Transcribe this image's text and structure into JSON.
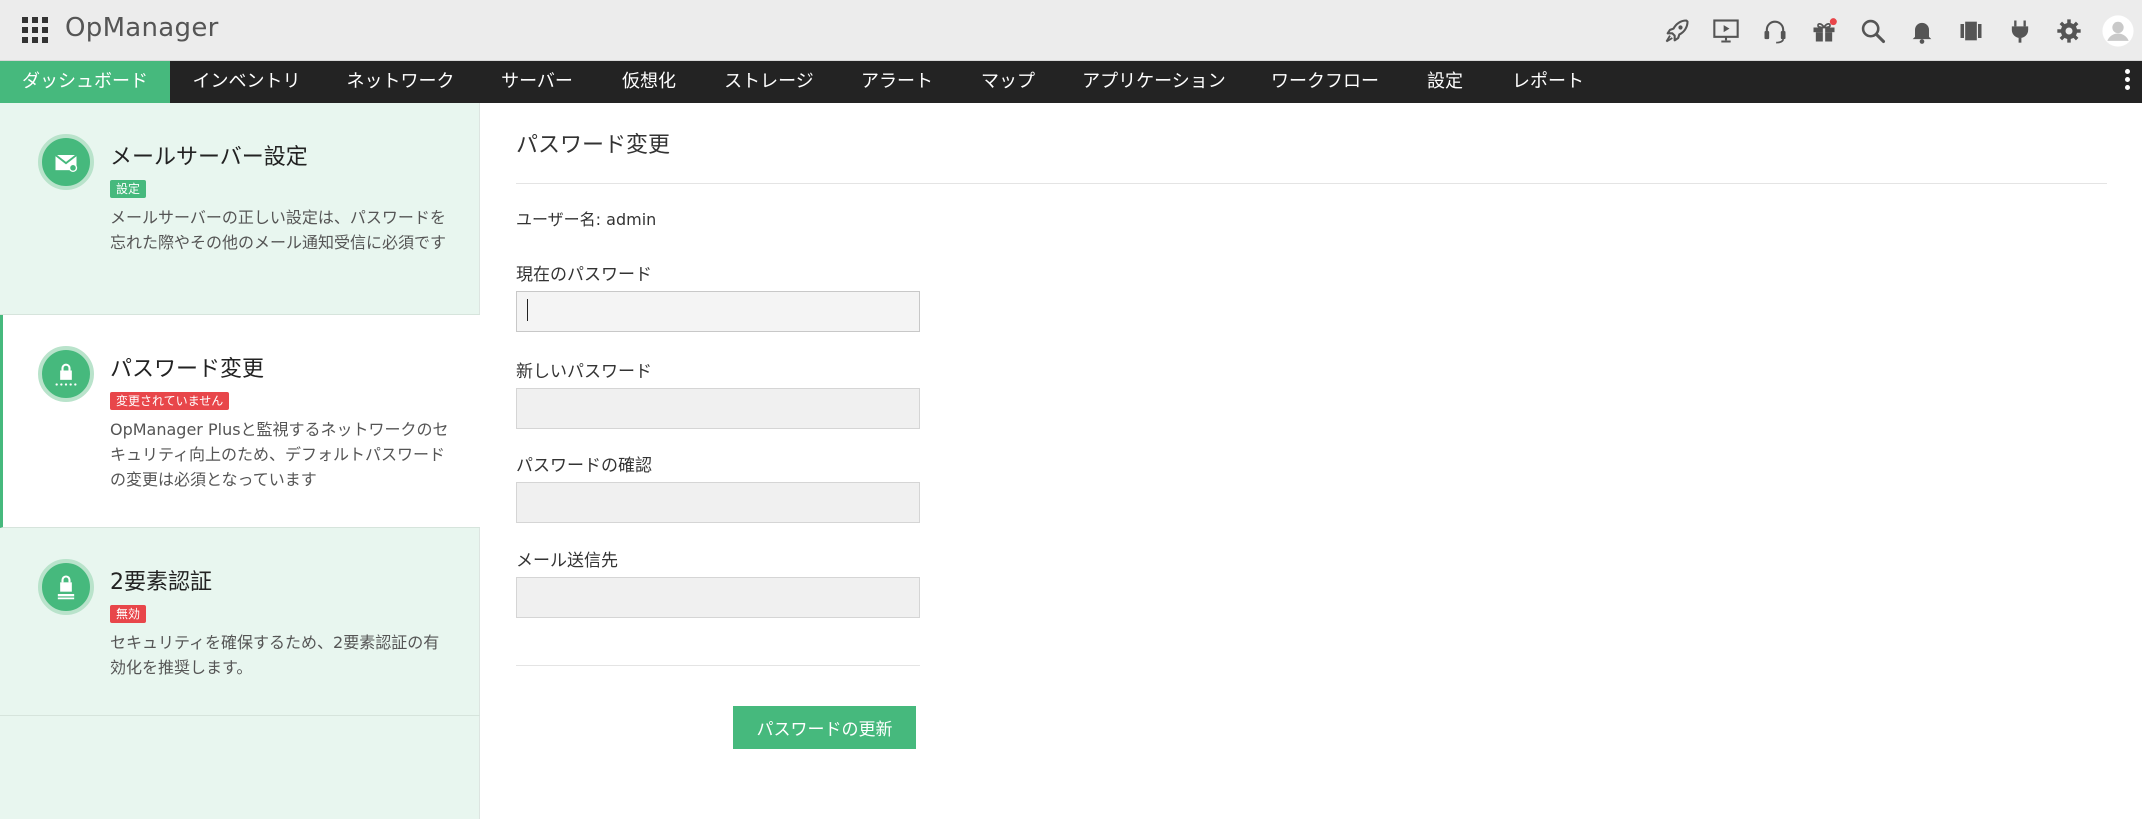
{
  "app": {
    "title": "OpManager"
  },
  "header_icons": [
    "rocket-icon",
    "presentation-icon",
    "headset-icon",
    "gift-icon",
    "search-icon",
    "bell-icon",
    "devices-icon",
    "plug-icon",
    "gear-icon",
    "avatar-icon"
  ],
  "nav": {
    "items": [
      {
        "label": "ダッシュボード",
        "active": true
      },
      {
        "label": "インベントリ"
      },
      {
        "label": "ネットワーク"
      },
      {
        "label": "サーバー"
      },
      {
        "label": "仮想化"
      },
      {
        "label": "ストレージ"
      },
      {
        "label": "アラート"
      },
      {
        "label": "マップ"
      },
      {
        "label": "アプリケーション"
      },
      {
        "label": "ワークフロー"
      },
      {
        "label": "設定"
      },
      {
        "label": "レポート"
      }
    ]
  },
  "sidebar": {
    "cards": [
      {
        "title": "メールサーバー設定",
        "badge": "設定",
        "badge_color": "#46b97d",
        "desc": "メールサーバーの正しい設定は、パスワードを忘れた際やその他のメール通知受信に必須です",
        "icon": "mail-icon"
      },
      {
        "title": "パスワード変更",
        "badge": "変更されていません",
        "badge_color": "#e8464a",
        "desc": "OpManager Plusと監視するネットワークのセキュリティ向上のため、デフォルトパスワードの変更は必須となっています",
        "icon": "password-lock-icon",
        "selected": true
      },
      {
        "title": "2要素認証",
        "badge": "無効",
        "badge_color": "#e8464a",
        "desc": "セキュリティを確保するため、2要素認証の有効化を推奨します。",
        "icon": "two-factor-lock-icon"
      }
    ]
  },
  "form": {
    "title": "パスワード変更",
    "user_label": "ユーザー名:",
    "user_value": "admin",
    "current_password_label": "現在のパスワード",
    "current_password_value": "",
    "new_password_label": "新しいパスワード",
    "new_password_value": "",
    "confirm_password_label": "パスワードの確認",
    "confirm_password_value": "",
    "email_label": "メール送信先",
    "email_value": "",
    "submit_label": "パスワードの更新"
  },
  "colors": {
    "accent": "#46b97d",
    "nav_bg": "#232323",
    "header_bg": "#ececec",
    "sidebar_bg": "#e8f6ef",
    "danger": "#e8464a"
  }
}
